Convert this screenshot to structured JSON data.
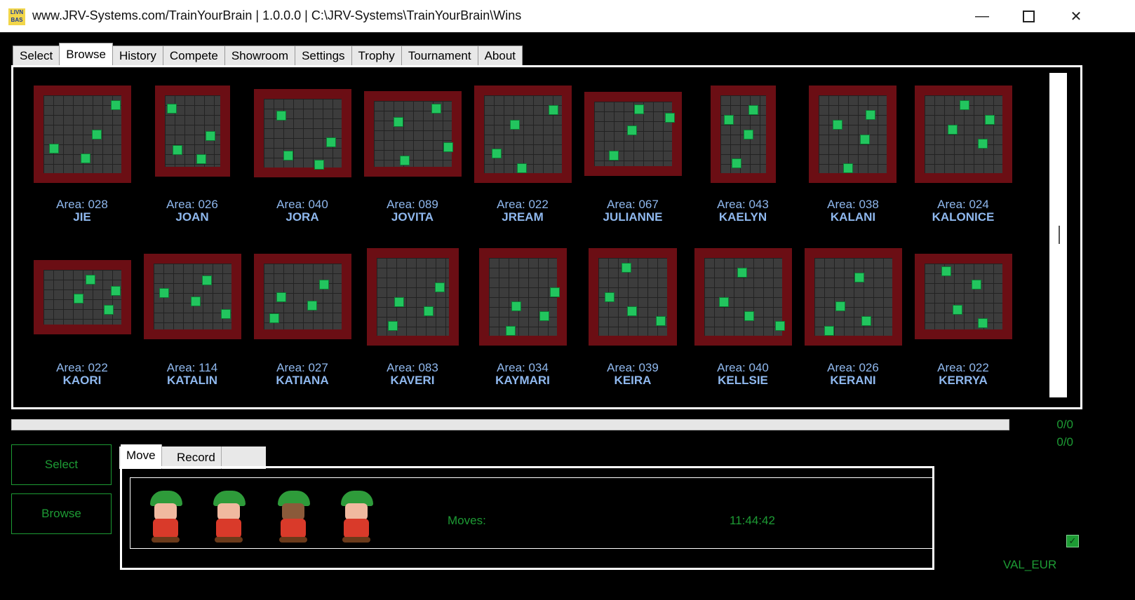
{
  "window": {
    "title": "www.JRV-Systems.com/TrainYourBrain | 1.0.0.0 | C:\\JRV-Systems\\TrainYourBrain\\Wins",
    "icon_text": "LIVN BAS"
  },
  "tabs": [
    "Select",
    "Browse",
    "History",
    "Compete",
    "Showroom",
    "Settings",
    "Trophy",
    "Tournament",
    "About"
  ],
  "active_tab": "Browse",
  "levels": [
    {
      "area": "Area: 028",
      "name": "JIE"
    },
    {
      "area": "Area: 026",
      "name": "JOAN"
    },
    {
      "area": "Area: 040",
      "name": "JORA"
    },
    {
      "area": "Area: 089",
      "name": "JOVITA"
    },
    {
      "area": "Area: 022",
      "name": "JREAM"
    },
    {
      "area": "Area: 067",
      "name": "JULIANNE"
    },
    {
      "area": "Area: 043",
      "name": "KAELYN"
    },
    {
      "area": "Area: 038",
      "name": "KALANI"
    },
    {
      "area": "Area: 024",
      "name": "KALONICE"
    },
    {
      "area": "Area: 022",
      "name": "KAORI"
    },
    {
      "area": "Area: 114",
      "name": "KATALIN"
    },
    {
      "area": "Area: 027",
      "name": "KATIANA"
    },
    {
      "area": "Area: 083",
      "name": "KAVERI"
    },
    {
      "area": "Area: 034",
      "name": "KAYMARI"
    },
    {
      "area": "Area: 039",
      "name": "KEIRA"
    },
    {
      "area": "Area: 040",
      "name": "KELLSIE"
    },
    {
      "area": "Area: 026",
      "name": "KERANI"
    },
    {
      "area": "Area: 022",
      "name": "KERRYA"
    }
  ],
  "counters": {
    "top": "0/0",
    "bottom": "0/0"
  },
  "buttons": {
    "select": "Select",
    "browse": "Browse"
  },
  "subtabs": [
    "Move",
    "Record"
  ],
  "active_subtab": "Move",
  "status": {
    "moves_label": "Moves:",
    "clock": "11:44:42",
    "val_label": "VAL_EUR"
  },
  "progress": 0
}
